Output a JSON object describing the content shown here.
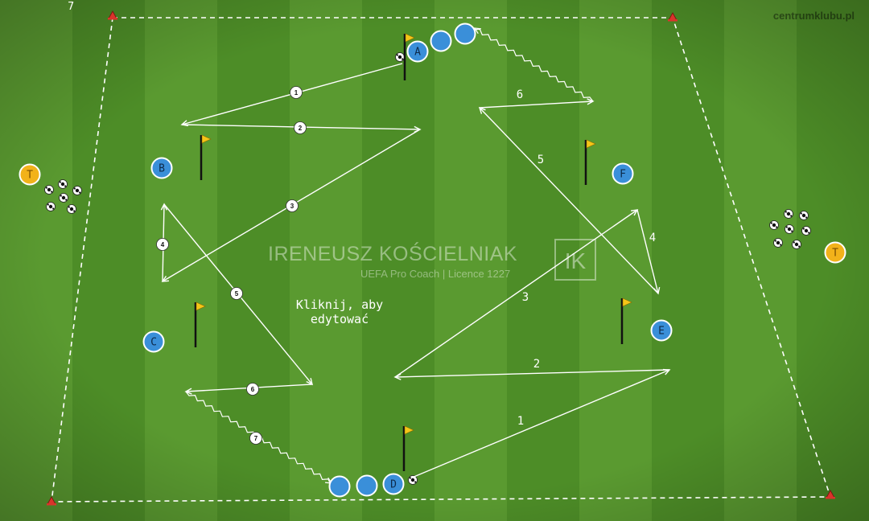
{
  "site_label": "centrumklubu.pl",
  "corner_number": "7",
  "watermark": {
    "name": "IRENEUSZ KOŚCIELNIAK",
    "subtitle": "UEFA Pro Coach   |   Licence 1227",
    "logo": "IK"
  },
  "edit_hint": "Kliknij, aby edytować",
  "colors": {
    "pitch_light": "#5a9a30",
    "pitch_dark": "#4d8d27",
    "player_blue": "#3a8fd9",
    "player_yellow": "#f2b21a",
    "flag_yellow": "#f5c518",
    "cone_red": "#d9342b",
    "line_white": "#ffffff"
  },
  "players": [
    {
      "label": "A",
      "team": "blue"
    },
    {
      "label": "",
      "team": "blue"
    },
    {
      "label": "",
      "team": "blue"
    },
    {
      "label": "B",
      "team": "blue"
    },
    {
      "label": "C",
      "team": "blue"
    },
    {
      "label": "D",
      "team": "blue"
    },
    {
      "label": "",
      "team": "blue"
    },
    {
      "label": "",
      "team": "blue"
    },
    {
      "label": "E",
      "team": "blue"
    },
    {
      "label": "F",
      "team": "blue"
    },
    {
      "label": "T",
      "team": "yellow"
    },
    {
      "label": "T",
      "team": "yellow"
    }
  ],
  "move_labels": {
    "left_circuit": [
      "1",
      "2",
      "3",
      "4",
      "5",
      "6",
      "7"
    ],
    "right_circuit": [
      "1",
      "2",
      "3",
      "4",
      "5",
      "6"
    ]
  },
  "icons": [
    "cone-icon",
    "flag-icon",
    "ball-icon",
    "player-marker-icon"
  ]
}
